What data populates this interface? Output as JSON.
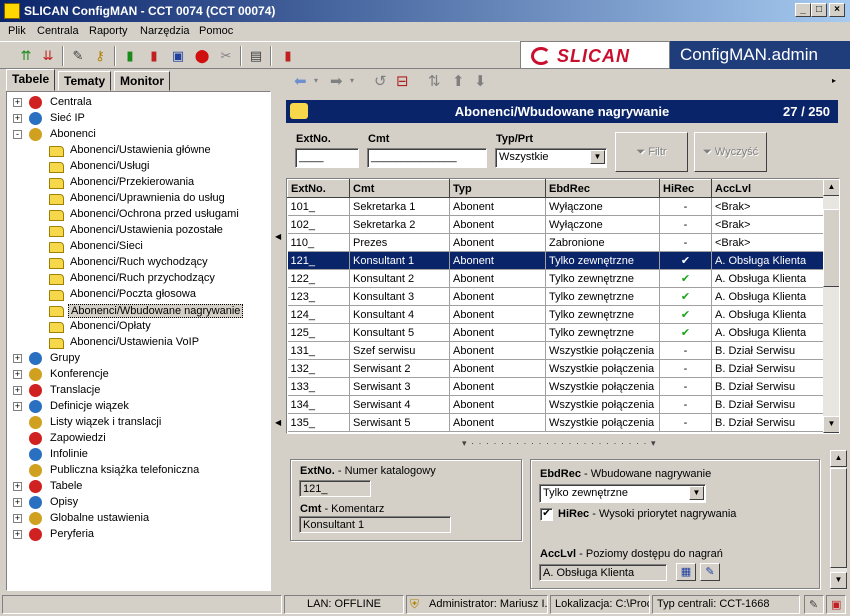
{
  "window": {
    "title": "SLICAN ConfigMAN - CCT 0074 (CCT 00074)"
  },
  "menu": [
    "Plik",
    "Centrala",
    "Raporty",
    "Narzędzia",
    "Pomoc"
  ],
  "banner": {
    "logo": "SLICAN",
    "app_name": "ConfigMAN.admin",
    "brand_color": "#c8102e"
  },
  "tabs": [
    "Tabele",
    "Tematy",
    "Monitor"
  ],
  "tree": [
    {
      "label": "Centrala",
      "level": 0,
      "exp": "+"
    },
    {
      "label": "Sieć IP",
      "level": 0,
      "exp": "+"
    },
    {
      "label": "Abonenci",
      "level": 0,
      "exp": "-"
    },
    {
      "label": "Abonenci/Ustawienia główne",
      "level": 1
    },
    {
      "label": "Abonenci/Usługi",
      "level": 1
    },
    {
      "label": "Abonenci/Przekierowania",
      "level": 1
    },
    {
      "label": "Abonenci/Uprawnienia do usług",
      "level": 1
    },
    {
      "label": "Abonenci/Ochrona przed usługami",
      "level": 1
    },
    {
      "label": "Abonenci/Ustawienia pozostałe",
      "level": 1
    },
    {
      "label": "Abonenci/Sieci",
      "level": 1
    },
    {
      "label": "Abonenci/Ruch wychodzący",
      "level": 1
    },
    {
      "label": "Abonenci/Ruch przychodzący",
      "level": 1
    },
    {
      "label": "Abonenci/Poczta głosowa",
      "level": 1
    },
    {
      "label": "Abonenci/Wbudowane nagrywanie",
      "level": 1,
      "selected": true
    },
    {
      "label": "Abonenci/Opłaty",
      "level": 1
    },
    {
      "label": "Abonenci/Ustawienia VoIP",
      "level": 1
    },
    {
      "label": "Grupy",
      "level": 0,
      "exp": "+"
    },
    {
      "label": "Konferencje",
      "level": 0,
      "exp": "+"
    },
    {
      "label": "Translacje",
      "level": 0,
      "exp": "+"
    },
    {
      "label": "Definicje wiązek",
      "level": 0,
      "exp": "+"
    },
    {
      "label": "Listy wiązek i translacji",
      "level": 0
    },
    {
      "label": "Zapowiedzi",
      "level": 0
    },
    {
      "label": "Infolinie",
      "level": 0
    },
    {
      "label": "Publiczna książka telefoniczna",
      "level": 0
    },
    {
      "label": "Tabele",
      "level": 0,
      "exp": "+"
    },
    {
      "label": "Opisy",
      "level": 0,
      "exp": "+"
    },
    {
      "label": "Globalne ustawienia",
      "level": 0,
      "exp": "+"
    },
    {
      "label": "Peryferia",
      "level": 0,
      "exp": "+"
    }
  ],
  "panel": {
    "title": "Abonenci/Wbudowane nagrywanie",
    "count": "27 / 250"
  },
  "filter": {
    "ext_label": "ExtNo.",
    "ext_value": "____",
    "cmt_label": "Cmt",
    "cmt_value": "______________",
    "typ_label": "Typ/Prt",
    "typ_value": "Wszystkie",
    "filter_btn": "Filtr",
    "clear_btn": "Wyczyść"
  },
  "grid": {
    "columns": [
      "ExtNo.",
      "Cmt",
      "Typ",
      "EbdRec",
      "HiRec",
      "AccLvl"
    ],
    "rows": [
      [
        "101_",
        "Sekretarka 1",
        "Abonent",
        "Wyłączone",
        "-",
        "<Brak>"
      ],
      [
        "102_",
        "Sekretarka 2",
        "Abonent",
        "Wyłączone",
        "-",
        "<Brak>"
      ],
      [
        "110_",
        "Prezes",
        "Abonent",
        "Zabronione",
        "-",
        "<Brak>"
      ],
      [
        "121_",
        "Konsultant 1",
        "Abonent",
        "Tylko zewnętrzne",
        "✔",
        "A. Obsługa Klienta"
      ],
      [
        "122_",
        "Konsultant 2",
        "Abonent",
        "Tylko zewnętrzne",
        "✔",
        "A. Obsługa Klienta"
      ],
      [
        "123_",
        "Konsultant 3",
        "Abonent",
        "Tylko zewnętrzne",
        "✔",
        "A. Obsługa Klienta"
      ],
      [
        "124_",
        "Konsultant 4",
        "Abonent",
        "Tylko zewnętrzne",
        "✔",
        "A. Obsługa Klienta"
      ],
      [
        "125_",
        "Konsultant 5",
        "Abonent",
        "Tylko zewnętrzne",
        "✔",
        "A. Obsługa Klienta"
      ],
      [
        "131_",
        "Szef serwisu",
        "Abonent",
        "Wszystkie połączenia",
        "-",
        "B. Dział Serwisu"
      ],
      [
        "132_",
        "Serwisant 2",
        "Abonent",
        "Wszystkie połączenia",
        "-",
        "B. Dział Serwisu"
      ],
      [
        "133_",
        "Serwisant 3",
        "Abonent",
        "Wszystkie połączenia",
        "-",
        "B. Dział Serwisu"
      ],
      [
        "134_",
        "Serwisant 4",
        "Abonent",
        "Wszystkie połączenia",
        "-",
        "B. Dział Serwisu"
      ],
      [
        "135_",
        "Serwisant 5",
        "Abonent",
        "Wszystkie połączenia",
        "-",
        "B. Dział Serwisu"
      ]
    ],
    "selected_row": 3
  },
  "detail": {
    "ext_label": "ExtNo.",
    "ext_desc": " - Numer katalogowy",
    "ext_value": "121_",
    "cmt_label": "Cmt",
    "cmt_desc": " - Komentarz",
    "cmt_value": "Konsultant 1",
    "ebd_label": "EbdRec",
    "ebd_desc": " - Wbudowane nagrywanie",
    "ebd_value": "Tylko zewnętrzne",
    "hirec_label": "HiRec",
    "hirec_desc": " - Wysoki priorytet nagrywania",
    "acc_label": "AccLvl",
    "acc_desc": " - Poziomy dostępu do nagrań",
    "acc_value": "A. Obsługa Klienta"
  },
  "status": {
    "lan": "LAN: OFFLINE",
    "user": "Administrator: Mariusz I.",
    "location": "Lokalizacja: C:\\Proc",
    "type": "Typ centrali: CCT-1668"
  }
}
